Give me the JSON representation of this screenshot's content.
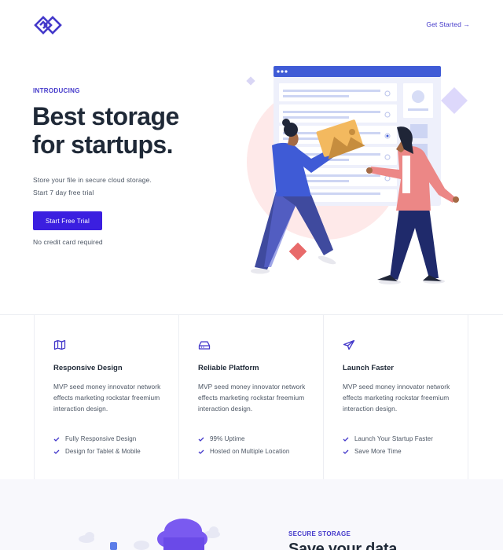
{
  "header": {
    "logo_icon": "diamond-chain-logo-icon",
    "cta_label": "Get Started →"
  },
  "hero": {
    "eyebrow": "INTRODUCING",
    "title_line1": "Best storage",
    "title_line2": "for startups.",
    "subtitle_line1": "Store your file in secure cloud storage.",
    "subtitle_line2": "Start 7 day free trial",
    "cta_label": "Start Free Trial",
    "note": "No credit card required",
    "illustration": "two-people-sharing-image-illustration"
  },
  "features": [
    {
      "icon": "map-icon",
      "title": "Responsive Design",
      "description": "MVP seed money innovator network effects marketing rockstar freemium interaction design.",
      "bullets": [
        "Fully Responsive Design",
        "Design for Tablet & Mobile"
      ]
    },
    {
      "icon": "hard-drive-icon",
      "title": "Reliable Platform",
      "description": "MVP seed money innovator network effects marketing rockstar freemium interaction design.",
      "bullets": [
        "99% Uptime",
        "Hosted on Multiple Location"
      ]
    },
    {
      "icon": "paper-plane-icon",
      "title": "Launch Faster",
      "description": "MVP seed money innovator network effects marketing rockstar freemium interaction design.",
      "bullets": [
        "Launch Your Startup Faster",
        "Save More Time"
      ]
    }
  ],
  "secure": {
    "eyebrow": "SECURE STORAGE",
    "title": "Save your data"
  },
  "colors": {
    "accent": "#4338ca",
    "button": "#3b1fe0",
    "text": "#1f2937",
    "muted": "#4b5563",
    "border": "#eceef3",
    "pink_blob": "#fde2e2"
  }
}
